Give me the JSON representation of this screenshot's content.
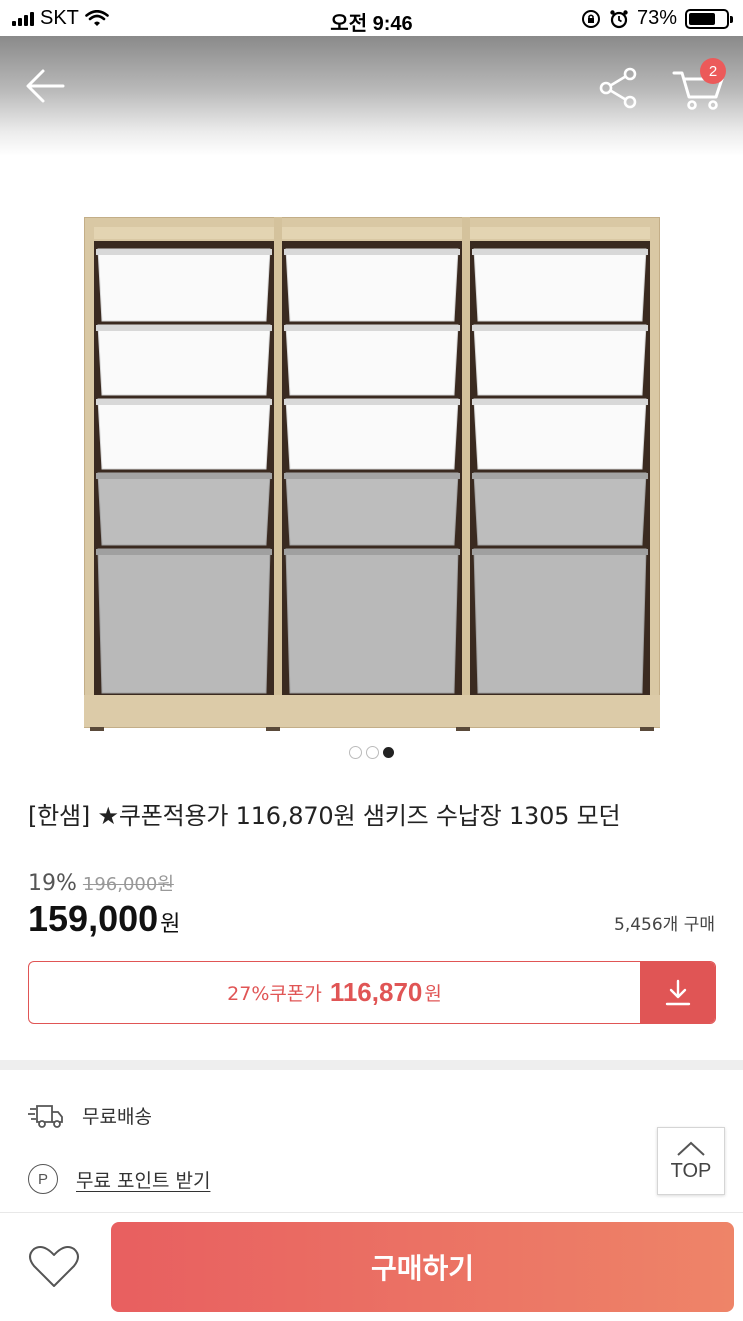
{
  "status_bar": {
    "carrier": "SKT",
    "time": "오전 9:46",
    "battery": "73%",
    "battery_level": 0.73
  },
  "nav": {
    "back_icon": "arrow-left-icon",
    "share_icon": "share-icon",
    "cart_icon": "cart-icon",
    "cart_badge": "2"
  },
  "product": {
    "image_icon": "storage-shelf-image",
    "carousel": {
      "total": 3,
      "active_index": 2
    },
    "title": "[한샘] ★쿠폰적용가 116,870원 샘키즈 수납장 1305 모던",
    "discount_rate": "19%",
    "original_price": "196,000원",
    "price": "159,000",
    "price_unit": "원",
    "purchase_count": "5,456개 구매"
  },
  "coupon": {
    "label": "27%쿠폰가",
    "price": "116,870",
    "price_unit": "원",
    "download_icon": "download-icon"
  },
  "benefits": {
    "shipping": "무료배송",
    "points": "무료 포인트 받기",
    "point_icon_letter": "P"
  },
  "top_button": "TOP",
  "bottom_bar": {
    "wish_icon": "heart-icon",
    "buy_label": "구매하기"
  },
  "colors": {
    "accent": "#e05555",
    "buy_gradient_start": "#e85f60",
    "buy_gradient_end": "#ee8468"
  }
}
